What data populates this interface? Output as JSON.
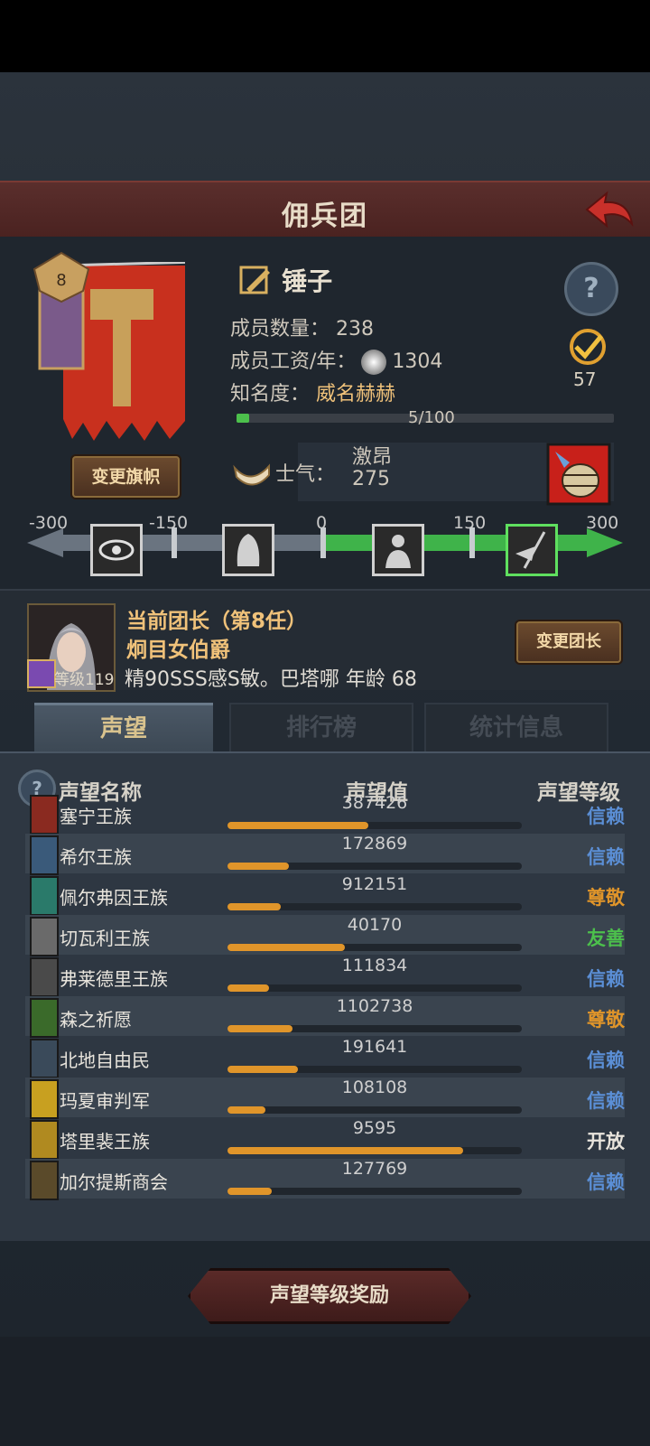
{
  "header": {
    "title": "佣兵团"
  },
  "guild": {
    "name": "锤子",
    "member_label": "成员数量：",
    "member_count": "238",
    "wage_label": "成员工资/年：",
    "wage": "1304",
    "fame_label": "知名度：",
    "fame_value": "威名赫赫",
    "fame_progress": "5/100",
    "fame_fraction": 0.05,
    "change_banner_label": "变更旗帜",
    "badge_number": "57",
    "morale_label": "士气：",
    "morale_state": "激昂",
    "morale_value": "275"
  },
  "morale_scale": {
    "labels": [
      "-300",
      "-150",
      "0",
      "150",
      "300"
    ],
    "icons": [
      "eye-icon",
      "hooded-figure-icon",
      "soldier-icon",
      "flag-bearer-icon"
    ],
    "active_index": 3
  },
  "leader": {
    "title": "当前团长（第8任）",
    "name": "炯目女伯爵",
    "level": "等级119",
    "info": "精90SSS感S敏。巴塔哪  年龄  68",
    "change_label": "变更团长"
  },
  "tabs": [
    "声望",
    "排行榜",
    "统计信息"
  ],
  "table": {
    "headers": [
      "声望名称",
      "声望值",
      "声望等级"
    ],
    "rows": [
      {
        "name": "塞宁王族",
        "value": "387426",
        "level": "信赖",
        "fill": 0.48,
        "crest": "#8a2a20",
        "color": "#5b8fd6"
      },
      {
        "name": "希尔王族",
        "value": "172869",
        "level": "信赖",
        "fill": 0.21,
        "crest": "#3a5a7a",
        "color": "#5b8fd6"
      },
      {
        "name": "佩尔弗因王族",
        "value": "912151",
        "level": "尊敬",
        "fill": 0.18,
        "crest": "#2a7a6a",
        "color": "#e0952a"
      },
      {
        "name": "切瓦利王族",
        "value": "40170",
        "level": "友善",
        "fill": 0.4,
        "crest": "#6a6a6a",
        "color": "#4cc04c"
      },
      {
        "name": "弗莱德里王族",
        "value": "111834",
        "level": "信赖",
        "fill": 0.14,
        "crest": "#4a4a4a",
        "color": "#5b8fd6"
      },
      {
        "name": "森之祈愿",
        "value": "1102738",
        "level": "尊敬",
        "fill": 0.22,
        "crest": "#3a6a2a",
        "color": "#e0952a"
      },
      {
        "name": "北地自由民",
        "value": "191641",
        "level": "信赖",
        "fill": 0.24,
        "crest": "#3a4a5a",
        "color": "#5b8fd6"
      },
      {
        "name": "玛夏审判军",
        "value": "108108",
        "level": "信赖",
        "fill": 0.13,
        "crest": "#c8a020",
        "color": "#5b8fd6"
      },
      {
        "name": "塔里裴王族",
        "value": "9595",
        "level": "开放",
        "fill": 0.8,
        "crest": "#b08a20",
        "color": "#e8e4dc"
      },
      {
        "name": "加尔提斯商会",
        "value": "127769",
        "level": "信赖",
        "fill": 0.15,
        "crest": "#5a4a2a",
        "color": "#5b8fd6"
      }
    ]
  },
  "reward_button": "声望等级奖励"
}
